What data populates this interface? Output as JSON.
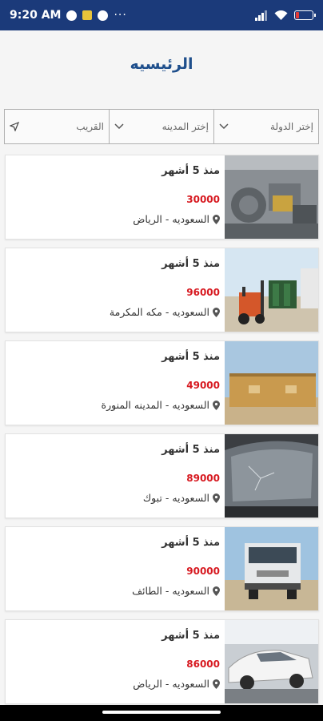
{
  "status_bar": {
    "time": "9:20 AM",
    "menu_dots": "···",
    "battery_level": 0.2
  },
  "header": {
    "title": "الرئيسيه"
  },
  "filters": {
    "country": "إختر الدولة",
    "city": "إختر المدينه",
    "nearby": "القريب"
  },
  "listings": [
    {
      "time": "منذ 5 أشهر",
      "price": "30000",
      "location": "السعوديه - الرياض",
      "image": "engine"
    },
    {
      "time": "منذ 5 أشهر",
      "price": "96000",
      "location": "السعوديه - مكه المكرمة",
      "image": "forklift"
    },
    {
      "time": "منذ 5 أشهر",
      "price": "49000",
      "location": "السعوديه - المدينه المنورة",
      "image": "portable-cabin"
    },
    {
      "time": "منذ 5 أشهر",
      "price": "89000",
      "location": "السعوديه - تبوك",
      "image": "windshield"
    },
    {
      "time": "منذ 5 أشهر",
      "price": "90000",
      "location": "السعوديه - الطائف",
      "image": "truck"
    },
    {
      "time": "منذ 5 أشهر",
      "price": "86000",
      "location": "السعوديه - الرياض",
      "image": "damaged-car"
    }
  ]
}
